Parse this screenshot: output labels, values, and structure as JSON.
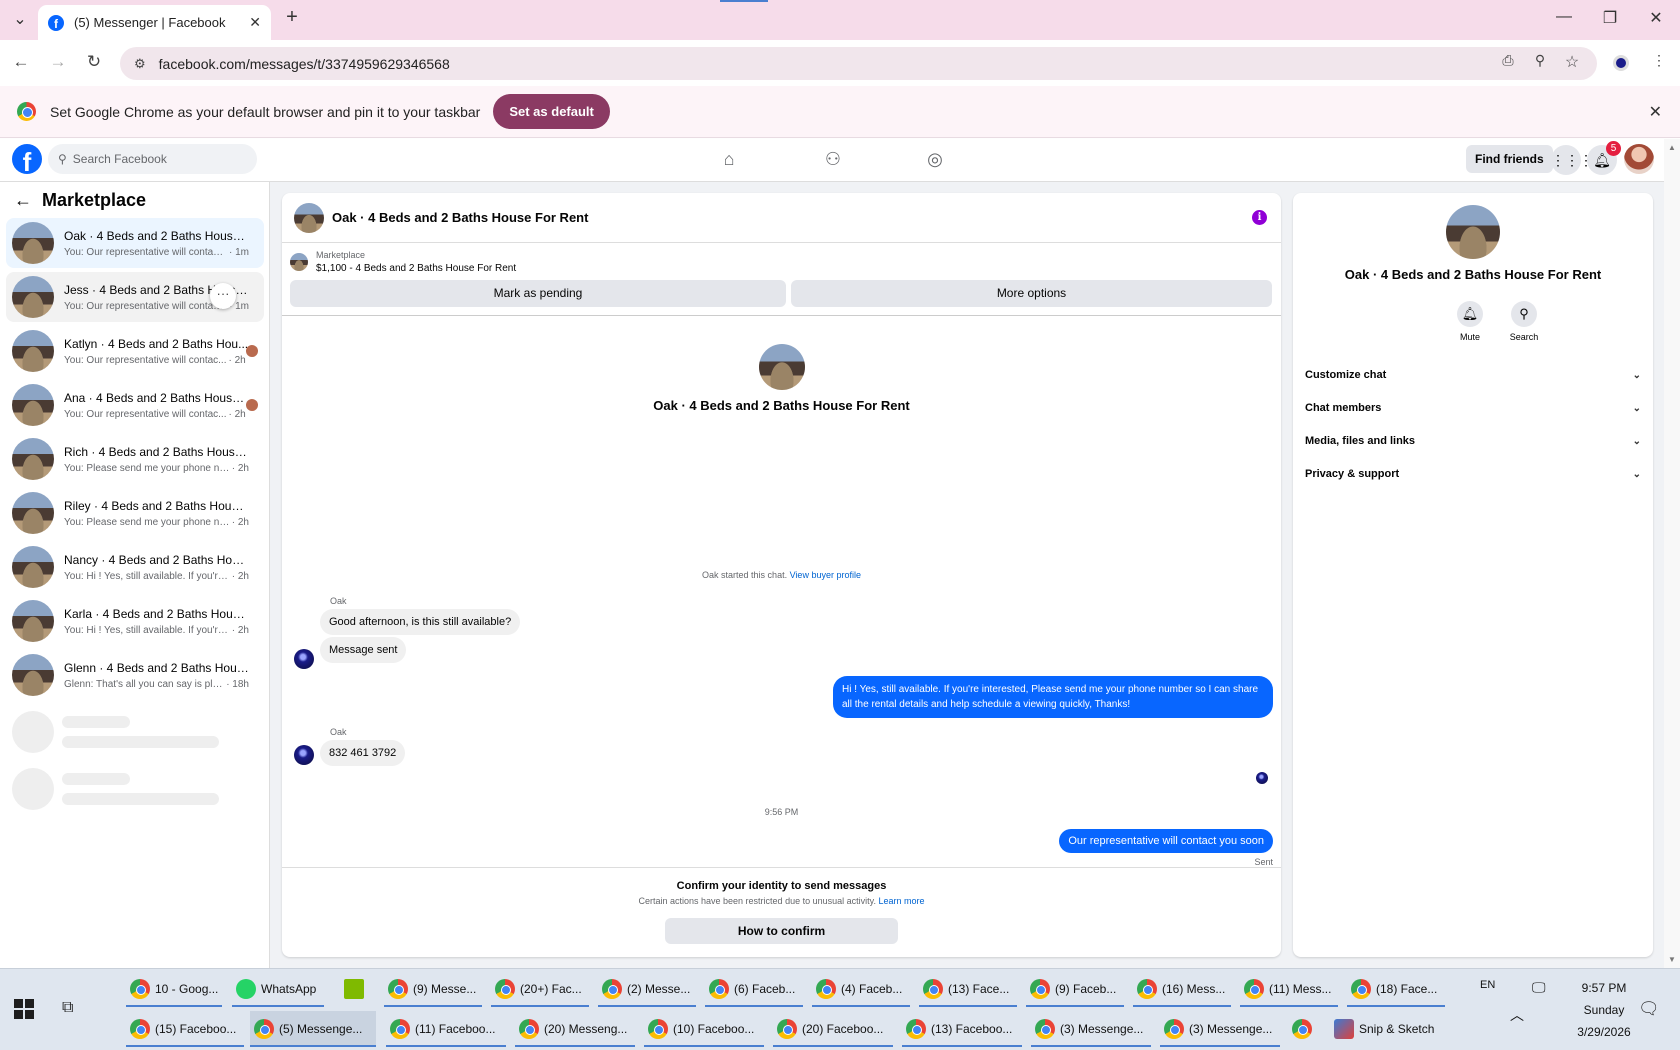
{
  "browser": {
    "tab_title": "(5) Messenger | Facebook",
    "url": "facebook.com/messages/t/3374959629346568",
    "infobar_message": "Set Google Chrome as your default browser and pin it to your taskbar",
    "infobar_button": "Set as default"
  },
  "fb_header": {
    "search_placeholder": "Search Facebook",
    "find_friends": "Find friends",
    "notification_count": "5"
  },
  "sidebar": {
    "title": "Marketplace",
    "conversations": [
      {
        "name": "Oak · 4 Beds and 2 Baths House F...",
        "preview": "You: Our representative will contact y...",
        "time": "· 1m"
      },
      {
        "name": "Jess · 4 Beds and 2 Baths House F...",
        "preview": "You: Our representative will contact y...",
        "time": "· 1m"
      },
      {
        "name": "Katlyn · 4 Beds and 2 Baths Hou...",
        "preview": "You: Our representative will contac...",
        "time": "· 2h"
      },
      {
        "name": "Ana · 4 Beds and 2 Baths House ...",
        "preview": "You: Our representative will contac...",
        "time": "· 2h"
      },
      {
        "name": "Rich · 4 Beds and 2 Baths House F...",
        "preview": "You: Please send me your phone num...",
        "time": "· 2h"
      },
      {
        "name": "Riley · 4 Beds and 2 Baths House F...",
        "preview": "You: Please send me your phone num...",
        "time": "· 2h"
      },
      {
        "name": "Nancy · 4 Beds and 2 Baths House ...",
        "preview": "You: Hi ! Yes, still available. If you're in...",
        "time": "· 2h"
      },
      {
        "name": "Karla · 4 Beds and 2 Baths House F...",
        "preview": "You: Hi ! Yes, still available. If you're in...",
        "time": "· 2h"
      },
      {
        "name": "Glenn · 4 Beds and 2 Baths House ...",
        "preview": "Glenn: That's all you can say is pleas...",
        "time": "· 18h"
      }
    ]
  },
  "chat": {
    "title": "Oak · 4 Beds and 2 Baths House For Rent",
    "listing_source": "Marketplace",
    "listing_detail": "$1,100 - 4 Beds and 2 Baths House For Rent",
    "mark_pending": "Mark as pending",
    "more_options": "More options",
    "profile_name": "Oak · 4 Beds and 2 Baths House For Rent",
    "started_text": "Oak started this chat.",
    "view_buyer_profile": "View buyer profile",
    "sender_name": "Oak",
    "msg_in_1": "Good afternoon, is this still available?",
    "msg_in_2": "Message sent",
    "msg_out_1": "Hi ! Yes, still available. If you're interested, Please send me your phone number so I can share all the rental details and help schedule a viewing quickly, Thanks!",
    "sender_name_2": "Oak",
    "msg_in_3": "832 461 3792",
    "timestamp": "9:56 PM",
    "msg_out_2": "Our representative will contact you soon",
    "sent_status": "Sent",
    "confirm_title": "Confirm your identity to send messages",
    "confirm_sub": "Certain actions have been restricted due to unusual activity.",
    "learn_more": "Learn more",
    "how_to_confirm": "How to confirm"
  },
  "details": {
    "name": "Oak · 4 Beds and 2 Baths House For Rent",
    "mute": "Mute",
    "search": "Search",
    "sections": [
      "Customize chat",
      "Chat members",
      "Media, files and links",
      "Privacy & support"
    ]
  },
  "taskbar": {
    "row1": [
      {
        "label": "10 - Goog...",
        "icon": "chrome-icon"
      },
      {
        "label": "WhatsApp",
        "icon": "whatsapp-icon"
      },
      {
        "label": "",
        "icon": "notepad-icon"
      },
      {
        "label": "(9) Messe...",
        "icon": "chrome-icon"
      },
      {
        "label": "(20+) Fac...",
        "icon": "chrome-icon"
      },
      {
        "label": "(2) Messe...",
        "icon": "chrome-icon"
      },
      {
        "label": "(6) Faceb...",
        "icon": "chrome-icon"
      },
      {
        "label": "(4) Faceb...",
        "icon": "chrome-icon"
      },
      {
        "label": "(13) Face...",
        "icon": "chrome-icon"
      },
      {
        "label": "(9) Faceb...",
        "icon": "chrome-icon"
      },
      {
        "label": "(16) Mess...",
        "icon": "chrome-icon"
      },
      {
        "label": "(11) Mess...",
        "icon": "chrome-icon"
      },
      {
        "label": "(18) Face...",
        "icon": "chrome-icon"
      }
    ],
    "row2": [
      {
        "label": "(15) Faceboo...",
        "icon": "chrome-icon"
      },
      {
        "label": "(5) Messenge...",
        "icon": "chrome-icon"
      },
      {
        "label": "(11) Faceboo...",
        "icon": "chrome-icon"
      },
      {
        "label": "(20) Messeng...",
        "icon": "chrome-icon"
      },
      {
        "label": "(10) Faceboo...",
        "icon": "chrome-icon"
      },
      {
        "label": "(20) Faceboo...",
        "icon": "chrome-icon"
      },
      {
        "label": "(13) Faceboo...",
        "icon": "chrome-icon"
      },
      {
        "label": "(3) Messenge...",
        "icon": "chrome-icon"
      },
      {
        "label": "(3) Messenge...",
        "icon": "chrome-icon"
      },
      {
        "label": "",
        "icon": "chrome-icon"
      },
      {
        "label": "Snip & Sketch",
        "icon": "snip-icon"
      }
    ],
    "lang": "EN",
    "time": "9:57 PM",
    "day": "Sunday",
    "date": "3/29/2026"
  }
}
